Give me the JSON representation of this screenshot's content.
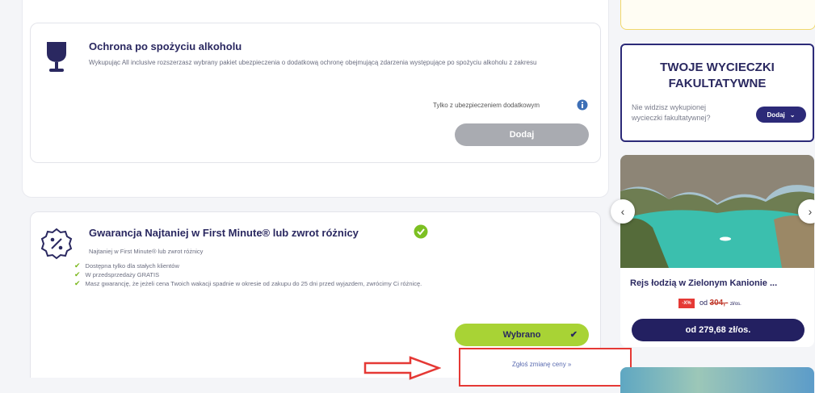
{
  "alcohol": {
    "title": "Ochrona po spożyciu alkoholu",
    "description": "Wykupując All inclusive rozszerzasz wybrany pakiet ubezpieczenia o dodatkową ochronę obejmującą zdarzenia występujące po spożyciu alkoholu z zakresu",
    "note": "Tylko z ubezpieczeniem dodatkowym",
    "add_label": "Dodaj"
  },
  "guarantee": {
    "title": "Gwarancja Najtaniej w First Minute® lub zwrot różnicy",
    "subtitle": "Najtaniej w First Minute® lub zwrot różnicy",
    "features": [
      "Dostępna tylko dla stałych klientów",
      "W przedsprzedaży GRATIS",
      "Masz gwarancję, że jeżeli cena Twoich wakacji spadnie w okresie od zakupu do 25 dni przed wyjazdem, zwrócimy Ci różnicę."
    ],
    "selected_label": "Wybrano",
    "report_link": "Zgłoś zmianę ceny »"
  },
  "excursions": {
    "title_line1": "TWOJE WYCIECZKI",
    "title_line2": "FAKULTATYWNE",
    "question": "Nie widzisz wykupionej wycieczki fakultatywnej?",
    "add_label": "Dodaj"
  },
  "trip": {
    "title": "Rejs łodzią w Zielonym Kanionie ...",
    "discount": "-X%",
    "price_prefix": "od",
    "old_price": "304,-",
    "old_price_unit": "zł/os.",
    "price_label": "od 279,68 zł/os."
  },
  "colors": {
    "navy": "#2a2860",
    "green": "#a8d335",
    "gray_button": "#a9abb1",
    "red": "#e53935"
  }
}
